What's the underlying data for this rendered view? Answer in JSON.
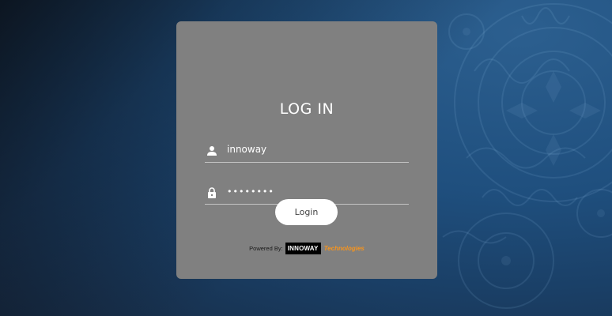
{
  "login": {
    "title": "LOG IN",
    "username": {
      "value": "innoway",
      "icon": "user-icon"
    },
    "password": {
      "value": "innoway1",
      "icon": "lock-icon"
    },
    "button_label": "Login"
  },
  "footer": {
    "powered_by": "Powered By:",
    "brand_logo": "INNOWAY",
    "brand_tech": "Technologies"
  },
  "colors": {
    "card": "#808080",
    "button": "#ffffff",
    "accent_orange": "#f7941d",
    "background_blue": "#1f4f7e"
  }
}
